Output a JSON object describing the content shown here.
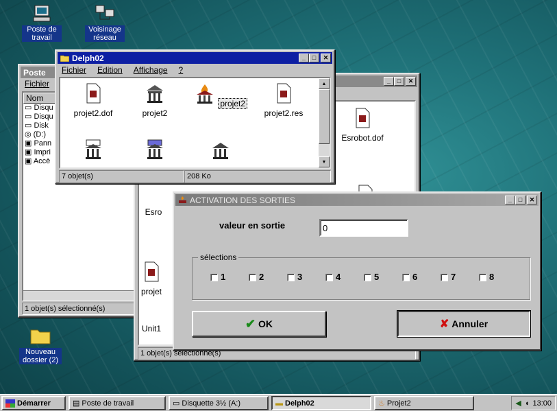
{
  "desktop": {
    "icons": [
      {
        "label": "Poste de travail",
        "icon": "my-computer-icon"
      },
      {
        "label": "Voisinage réseau",
        "icon": "network-neighborhood-icon"
      },
      {
        "label": "Nouveau dossier (2)",
        "icon": "folder-icon"
      }
    ]
  },
  "poste_window": {
    "title": "Poste",
    "menu": [
      "Fichier"
    ],
    "column": "Nom",
    "items": [
      "Disqu",
      "Disqu",
      "Disk",
      "(D:)",
      "Pann",
      "Impri",
      "Accè"
    ],
    "status": "1 objet(s) sélectionné(s)"
  },
  "projet_window": {
    "title": "Projet2",
    "files": [
      "Esrobot.dof",
      "Esro",
      "projet",
      "Unit1"
    ],
    "status": "1 objet(s) sélectionné(s)"
  },
  "delph_window": {
    "title": "Delph02",
    "menu": [
      "Fichier",
      "Edition",
      "Affichage",
      "?"
    ],
    "files": [
      {
        "name": "projet2.dof",
        "icon": "dof-file-icon"
      },
      {
        "name": "projet2",
        "icon": "project-icon"
      },
      {
        "name": "projet2",
        "icon": "delphi-torch-icon"
      },
      {
        "name": "projet2.res",
        "icon": "res-file-icon"
      },
      {
        "name": "",
        "icon": "pas-file-icon"
      },
      {
        "name": "",
        "icon": "dcu-file-icon"
      },
      {
        "name": "",
        "icon": "unit-file-icon"
      }
    ],
    "status_count": "7 objet(s)",
    "status_size": "208 Ko"
  },
  "dialog": {
    "title": "ACTIVATION DES SORTIES",
    "field_label": "valeur en sortie",
    "field_value": "0",
    "group_label": "sélections",
    "checkboxes": [
      "1",
      "2",
      "3",
      "4",
      "5",
      "6",
      "7",
      "8"
    ],
    "ok_label": "OK",
    "cancel_label": "Annuler"
  },
  "taskbar": {
    "start": "Démarrer",
    "tasks": [
      "Poste de travail",
      "Disquette 3½ (A:)",
      "Delph02",
      "Projet2"
    ],
    "clock": "13:00"
  },
  "colors": {
    "active_title": "#0d1fa3",
    "inactive_title": "#8a8a8a",
    "desktop": "#1f7178"
  }
}
